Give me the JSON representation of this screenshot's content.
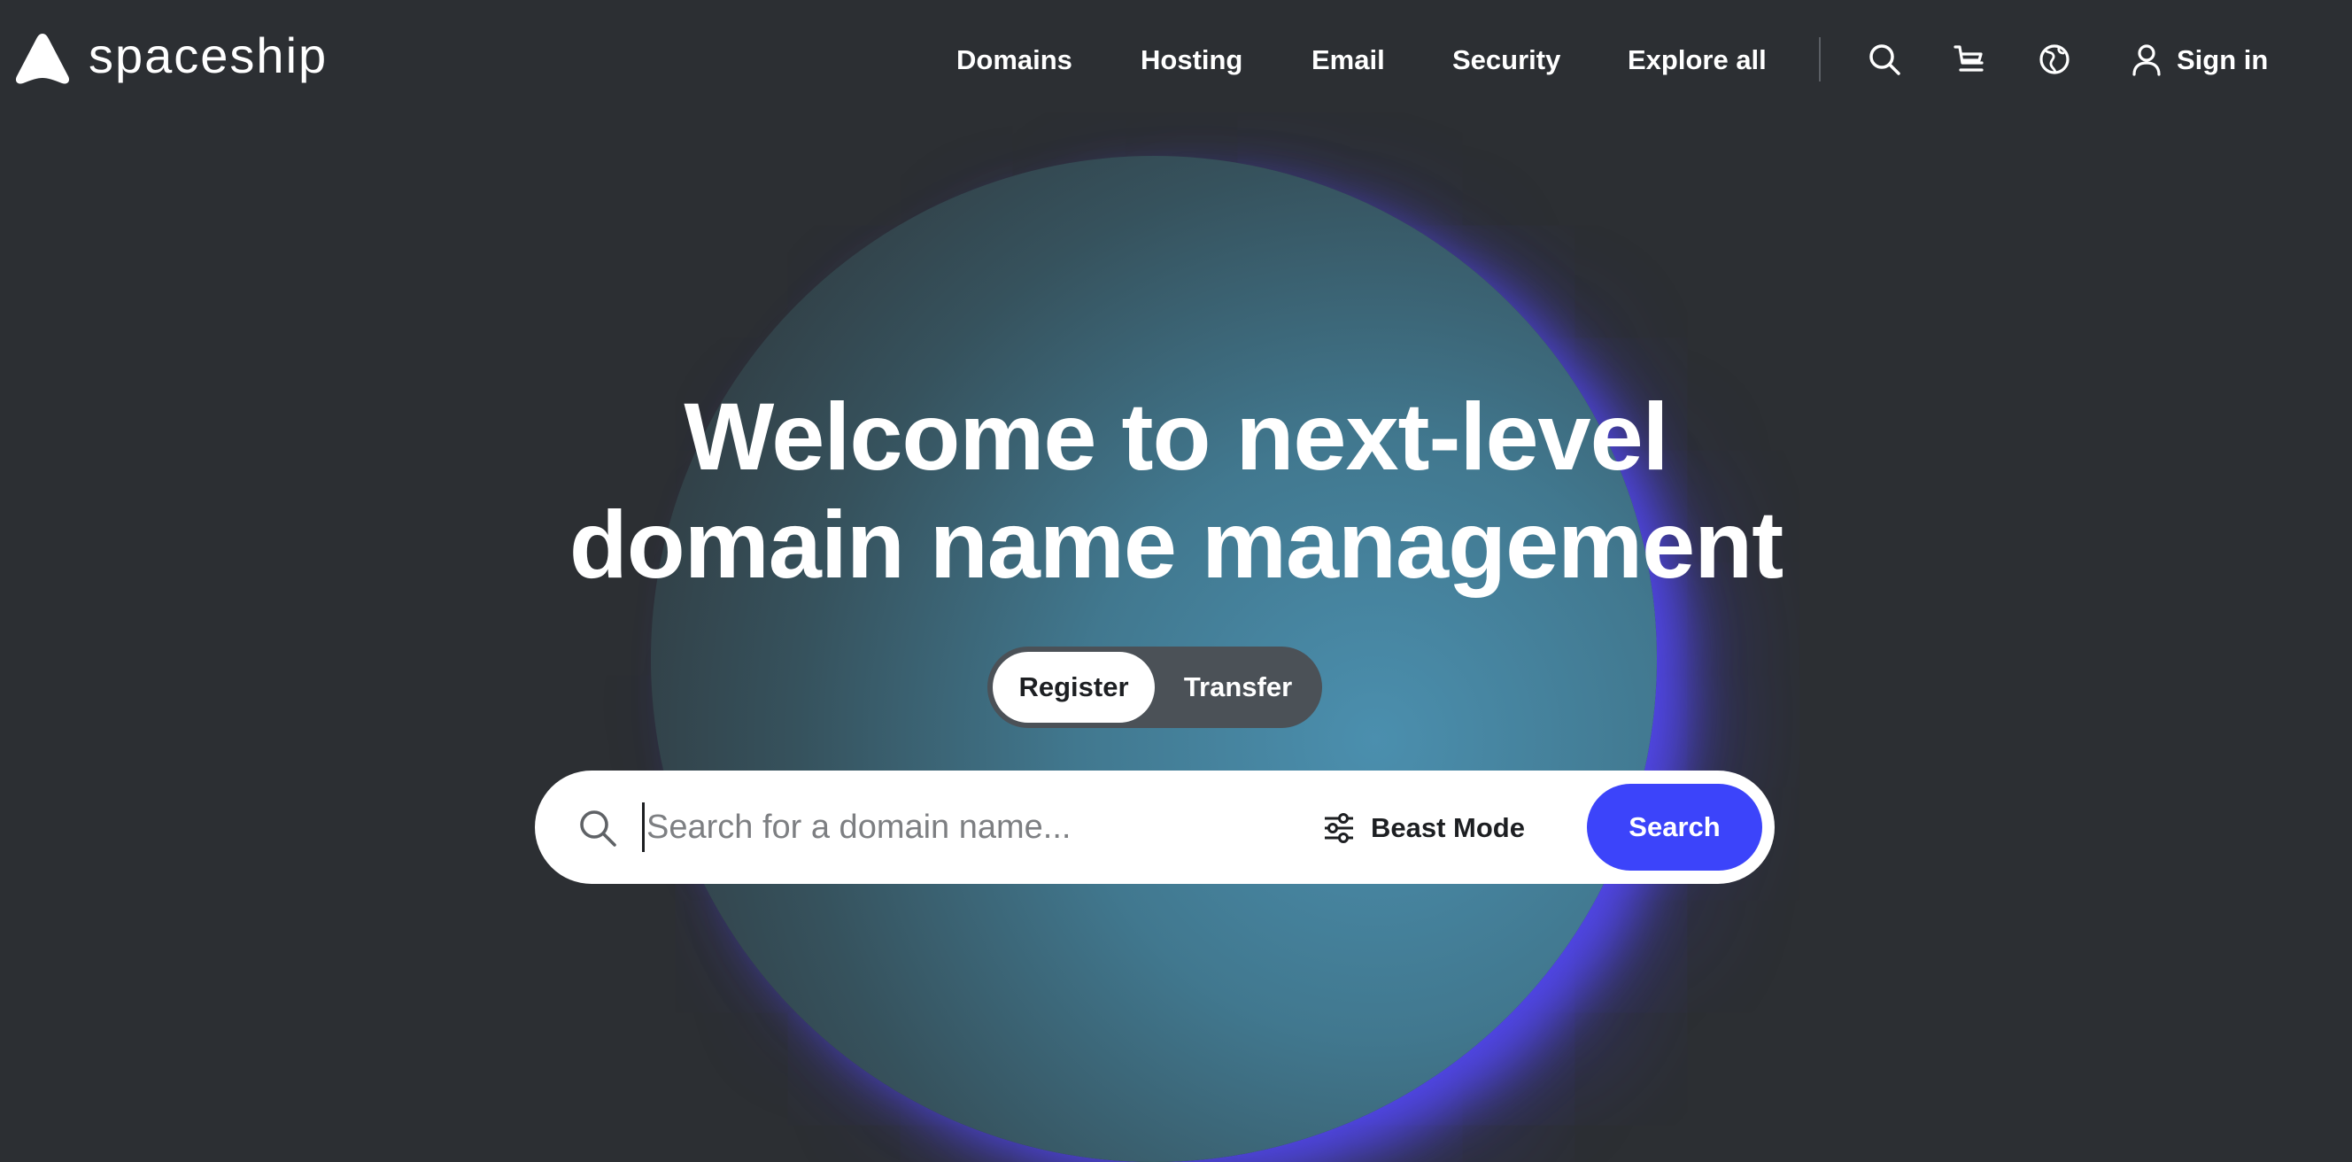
{
  "brand": {
    "name": "spaceship",
    "logo_icon": "rocket-triangle-icon"
  },
  "nav": {
    "links": [
      "Domains",
      "Hosting",
      "Email",
      "Security",
      "Explore all"
    ],
    "icons": [
      "search-icon",
      "cart-icon",
      "globe-icon",
      "user-icon"
    ],
    "sign_in": "Sign in"
  },
  "hero": {
    "title_line1": "Welcome to next-level",
    "title_line2": "domain name management"
  },
  "mode_toggle": {
    "options": [
      "Register",
      "Transfer"
    ],
    "selected": "Register"
  },
  "search": {
    "icon": "search-icon",
    "placeholder": "Search for a domain name...",
    "value": "",
    "beast_mode_icon": "sliders-icon",
    "beast_mode_label": "Beast Mode",
    "button_label": "Search"
  },
  "colors": {
    "background": "#2c2f33",
    "accent": "#3c44fa",
    "planet": "#41788f",
    "glow": "#564aff"
  }
}
